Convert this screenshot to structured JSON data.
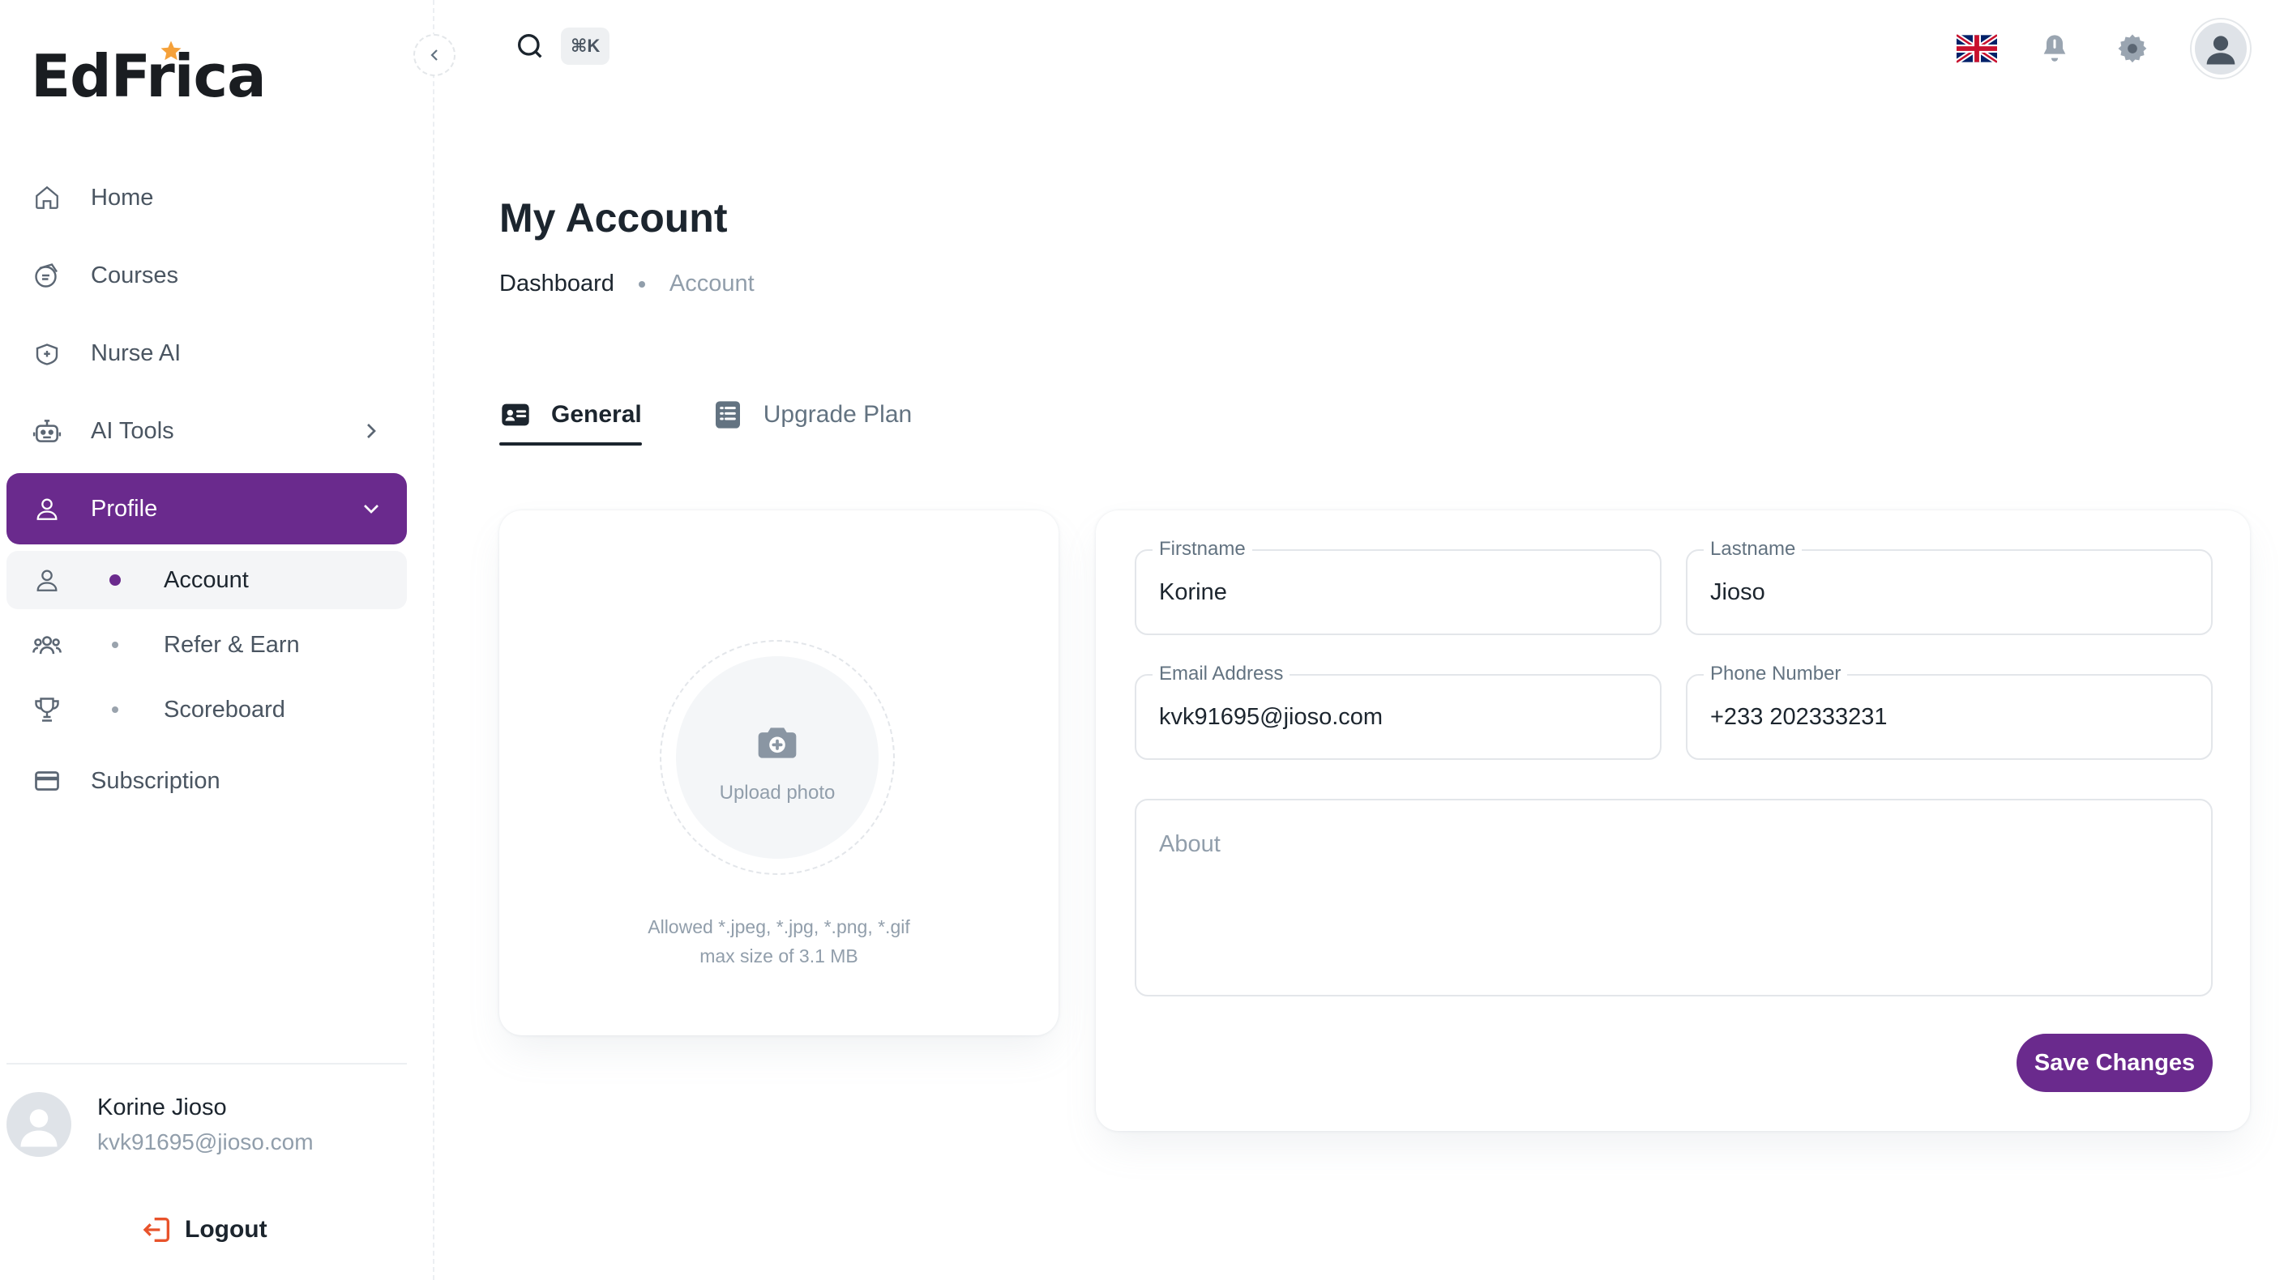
{
  "brand": {
    "name": "EdFrica",
    "star_color": "#f5a13a"
  },
  "colors": {
    "accent": "#6a2a8d",
    "text": "#1c252e",
    "muted": "#919eab",
    "logout": "#e8532b"
  },
  "sidebar": {
    "items": [
      {
        "label": "Home",
        "icon": "home-icon"
      },
      {
        "label": "Courses",
        "icon": "courses-icon"
      },
      {
        "label": "Nurse AI",
        "icon": "nurse-ai-icon"
      },
      {
        "label": "AI Tools",
        "icon": "robot-icon"
      },
      {
        "label": "Profile",
        "icon": "user-icon"
      },
      {
        "label": "Subscription",
        "icon": "card-icon"
      }
    ],
    "profile_sub": [
      {
        "label": "Account",
        "icon": "user-icon"
      },
      {
        "label": "Refer & Earn",
        "icon": "group-icon"
      },
      {
        "label": "Scoreboard",
        "icon": "trophy-icon"
      }
    ],
    "user": {
      "name": "Korine Jioso",
      "email": "kvk91695@jioso.com"
    },
    "logout_label": "Logout"
  },
  "header": {
    "search_shortcut": "⌘K",
    "language_icon": "uk-flag-icon"
  },
  "main": {
    "title": "My Account",
    "breadcrumb": [
      "Dashboard",
      "Account"
    ],
    "tabs": [
      {
        "label": "General",
        "icon": "id-card-icon"
      },
      {
        "label": "Upgrade Plan",
        "icon": "list-icon"
      }
    ],
    "photo": {
      "upload_label": "Upload photo",
      "hint_line1": "Allowed *.jpeg, *.jpg, *.png, *.gif",
      "hint_line2": "max size of 3.1 MB"
    },
    "form": {
      "firstname": {
        "label": "Firstname",
        "value": "Korine"
      },
      "lastname": {
        "label": "Lastname",
        "value": "Jioso"
      },
      "email": {
        "label": "Email Address",
        "value": "kvk91695@jioso.com"
      },
      "phone": {
        "label": "Phone Number",
        "value": "+233 202333231"
      },
      "about": {
        "placeholder": "About"
      },
      "save_label": "Save Changes"
    }
  }
}
